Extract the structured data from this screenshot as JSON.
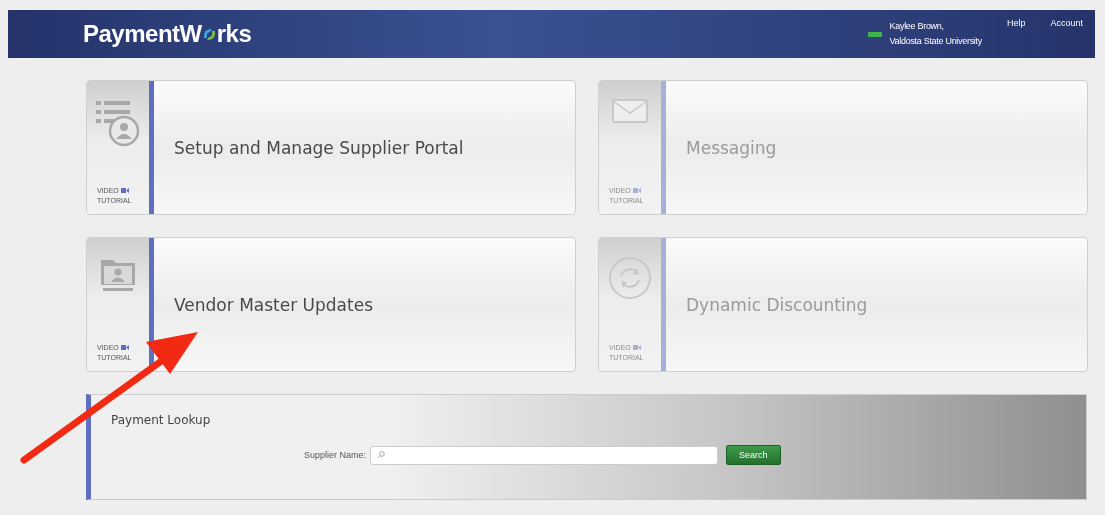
{
  "header": {
    "logo_start": "PaymentW",
    "logo_end": "rks",
    "user_name": "Kaylee Brown,",
    "organization": "Valdosta State University",
    "links": [
      "Help",
      "Account"
    ]
  },
  "tiles": [
    {
      "kind": "portal",
      "title": "Setup and Manage Supplier Portal",
      "video_label": "VIDEO",
      "tutorial_label": "TUTORIAL",
      "disabled": false
    },
    {
      "kind": "messaging",
      "title": "Messaging",
      "video_label": "VIDEO",
      "tutorial_label": "TUTORIAL",
      "disabled": true
    },
    {
      "kind": "vendor",
      "title": "Vendor Master Updates",
      "video_label": "VIDEO",
      "tutorial_label": "TUTORIAL",
      "disabled": false
    },
    {
      "kind": "discount",
      "title": "Dynamic Discounting",
      "video_label": "VIDEO",
      "tutorial_label": "TUTORIAL",
      "disabled": true
    }
  ],
  "payment_lookup": {
    "title": "Payment Lookup",
    "field_label": "Supplier Name:",
    "button": "Search"
  }
}
